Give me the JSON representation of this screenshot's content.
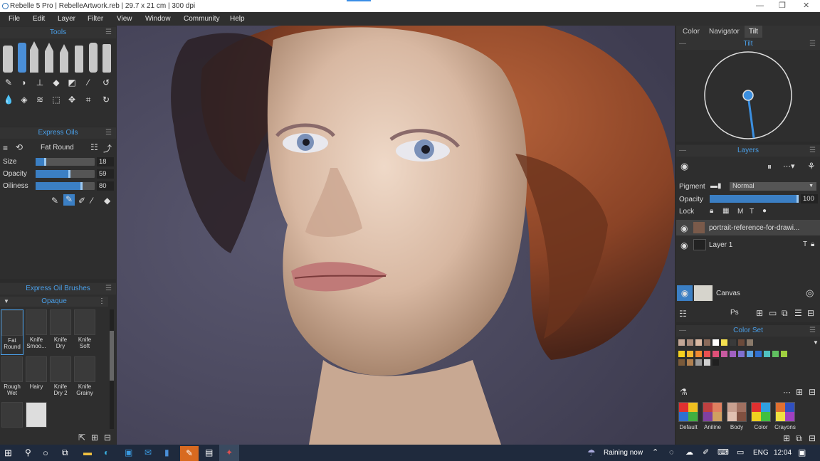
{
  "window": {
    "title": "Rebelle 5 Pro | RebelleArtwork.reb | 29.7 x 21 cm | 300 dpi",
    "minimize": "—",
    "maximize": "❐",
    "close": "✕"
  },
  "menu": [
    "File",
    "Edit",
    "Layer",
    "Filter",
    "View",
    "Window",
    "Community",
    "Help"
  ],
  "tools_panel": {
    "title": "Tools"
  },
  "brush_panel": {
    "title": "Express Oils",
    "brush_name": "Fat Round",
    "size_label": "Size",
    "size_value": "18",
    "size": 0.18,
    "opacity_label": "Opacity",
    "opacity_value": "59",
    "opacity": 0.59,
    "oiliness_label": "Oiliness",
    "oiliness_value": "80",
    "oiliness": 0.8
  },
  "brushes_panel": {
    "title": "Express Oil Brushes",
    "group": "Opaque",
    "items": [
      {
        "label1": "Fat",
        "label2": "Round"
      },
      {
        "label1": "Knife",
        "label2": "Smoo..."
      },
      {
        "label1": "Knife",
        "label2": "Dry"
      },
      {
        "label1": "Knife",
        "label2": "Soft"
      },
      {
        "label1": "Rough",
        "label2": "Wet"
      },
      {
        "label1": "Hairy",
        "label2": ""
      },
      {
        "label1": "Knife",
        "label2": "Dry 2"
      },
      {
        "label1": "Knife",
        "label2": "Grainy"
      }
    ]
  },
  "right_tabs": [
    "Color",
    "Navigator",
    "Tilt"
  ],
  "tilt_panel": {
    "title": "Tilt"
  },
  "layers_panel": {
    "title": "Layers",
    "pigment_label": "Pigment",
    "blend_mode": "Normal",
    "opacity_label": "Opacity",
    "opacity_value": "100",
    "lock_label": "Lock",
    "layers": [
      {
        "name": "portrait-reference-for-drawi..."
      },
      {
        "name": "Layer 1"
      }
    ],
    "canvas_label": "Canvas"
  },
  "colorset_panel": {
    "title": "Color Set",
    "row1": [
      "#c4a797",
      "#a98b7c",
      "#d9b8a3",
      "#8a6a5a",
      "#ffffff",
      "#f5e050",
      "#3a3a3a",
      "#6b4a3a",
      "#8a7a6a"
    ],
    "row2": [
      "#f5d020",
      "#f2b630",
      "#f08a30",
      "#e85050",
      "#e05078",
      "#c85aa0",
      "#a060c0",
      "#8070d0",
      "#5aa0e0",
      "#3070d0",
      "#50c0c0",
      "#60c060",
      "#a0d040"
    ],
    "row3": [
      "#7a5a3a",
      "#b08050",
      "#9a9a9a",
      "#d0d0d0",
      "#202020"
    ],
    "sets": [
      "Default",
      "Aniline",
      "Body",
      "Color",
      "Crayons"
    ]
  },
  "taskbar": {
    "weather": "Raining now",
    "lang": "ENG",
    "time": "12:04"
  },
  "colors": {
    "accent": "#4a9fe8",
    "panel": "#2e2e2e",
    "taskbar": "#1f2a3d"
  }
}
